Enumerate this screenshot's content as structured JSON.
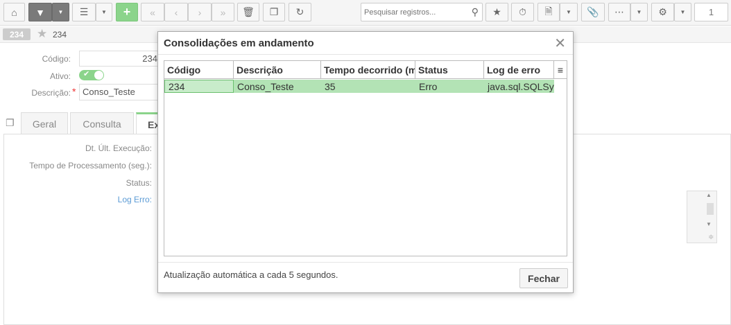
{
  "toolbar": {
    "icons": [
      "home-icon",
      "filter-icon",
      "caret-down-icon",
      "list-icon",
      "caret-down-icon",
      "plus-icon",
      "first-icon",
      "prev-icon",
      "next-icon",
      "last-icon",
      "trash-icon",
      "copy-icon",
      "refresh-icon",
      "search-icon",
      "star-icon",
      "timer-icon",
      "file-icon",
      "caret-down-icon",
      "paperclip-icon",
      "more-icon",
      "caret-down-icon",
      "gear-icon",
      "caret-down-icon"
    ],
    "search_placeholder": "Pesquisar registros...",
    "page_number": "1"
  },
  "record": {
    "badge": "234",
    "title": "234"
  },
  "form": {
    "codigo_label": "Código:",
    "codigo_value": "234",
    "ativo_label": "Ativo:",
    "descricao_label": "Descrição:",
    "descricao_value": "Conso_Teste"
  },
  "tabs": [
    {
      "label": "Geral"
    },
    {
      "label": "Consulta"
    },
    {
      "label": "Ex"
    }
  ],
  "panel": {
    "dt_label": "Dt. Últ. Execução:",
    "tempo_label": "Tempo de Processamento (seg.):",
    "status_label": "Status:",
    "log_label": "Log Erro:"
  },
  "dialog": {
    "title": "Consolidações em andamento",
    "columns": [
      "Código",
      "Descrição",
      "Tempo decorrido (mi",
      "Status",
      "Log de erro"
    ],
    "rows": [
      {
        "codigo": "234",
        "descricao": "Conso_Teste",
        "tempo": "35",
        "status": "Erro",
        "log": "java.sql.SQLSyn"
      }
    ],
    "footer_text": "Atualização automática a cada 5 segundos.",
    "close_button": "Fechar"
  },
  "colors": {
    "accent_green": "#8bd48b",
    "row_highlight": "#b3e3b5",
    "required": "#e33333"
  }
}
